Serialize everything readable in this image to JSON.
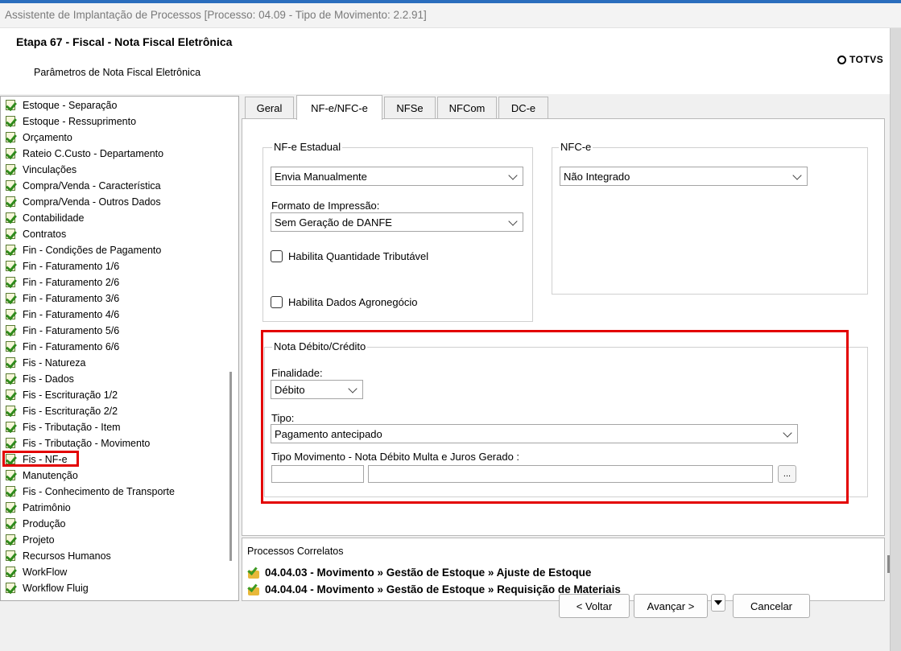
{
  "window": {
    "title": "Assistente de Implantação de Processos [Processo: 04.09 - Tipo de Movimento: 2.2.91]"
  },
  "header": {
    "step_title": "Etapa 67 - Fiscal - Nota Fiscal Eletrônica",
    "subtitle": "Parâmetros de Nota Fiscal Eletrônica",
    "logo_text": "TOTVS"
  },
  "tree": {
    "items": [
      "Estoque - Separação",
      "Estoque - Ressuprimento",
      "Orçamento",
      "Rateio C.Custo - Departamento",
      "Vinculações",
      "Compra/Venda - Característica",
      "Compra/Venda - Outros Dados",
      "Contabilidade",
      "Contratos",
      "Fin - Condições de Pagamento",
      "Fin - Faturamento 1/6",
      "Fin - Faturamento 2/6",
      "Fin - Faturamento 3/6",
      "Fin - Faturamento 4/6",
      "Fin - Faturamento 5/6",
      "Fin - Faturamento 6/6",
      "Fis - Natureza",
      "Fis - Dados",
      "Fis - Escrituração 1/2",
      "Fis - Escrituração 2/2",
      "Fis - Tributação - Item",
      "Fis - Tributação - Movimento",
      "Fis - NF-e",
      "Manutenção",
      "Fis - Conhecimento de Transporte",
      "Patrimônio",
      "Produção",
      "Projeto",
      "Recursos Humanos",
      "WorkFlow",
      "Workflow Fluig"
    ],
    "selected": "Fis - NF-e"
  },
  "tabs": [
    "Geral",
    "NF-e/NFC-e",
    "NFSe",
    "NFCom",
    "DC-e"
  ],
  "active_tab": "NF-e/NFC-e",
  "nfe": {
    "group_title": "NF-e Estadual",
    "envio_value": "Envia Manualmente",
    "formato_label": "Formato de Impressão:",
    "formato_value": "Sem Geração de DANFE",
    "habilita_qtd_label": "Habilita Quantidade Tributável",
    "habilita_qtd_checked": false,
    "habilita_agro_label": "Habilita Dados Agronegócio",
    "habilita_agro_checked": false
  },
  "nfce": {
    "group_title": "NFC-e",
    "value": "Não Integrado"
  },
  "nota": {
    "group_title": "Nota Débito/Crédito",
    "finalidade_label": "Finalidade:",
    "finalidade_value": "Débito",
    "tipo_label": "Tipo:",
    "tipo_value": "Pagamento antecipado",
    "tipo_mov_label": "Tipo Movimento - Nota Débito Multa e Juros Gerado :",
    "tipo_mov_code": "",
    "tipo_mov_desc": "",
    "browse_label": "..."
  },
  "correlatos": {
    "title": "Processos Correlatos",
    "items": [
      "04.04.03 - Movimento » Gestão de Estoque » Ajuste de Estoque",
      "04.04.04 - Movimento » Gestão de Estoque » Requisição de Materiais"
    ]
  },
  "buttons": {
    "back": "< Voltar",
    "next": "Avançar >",
    "cancel": "Cancelar"
  },
  "colors": {
    "highlight": "#e30000",
    "title_bar_accent": "#2a6dbd"
  }
}
